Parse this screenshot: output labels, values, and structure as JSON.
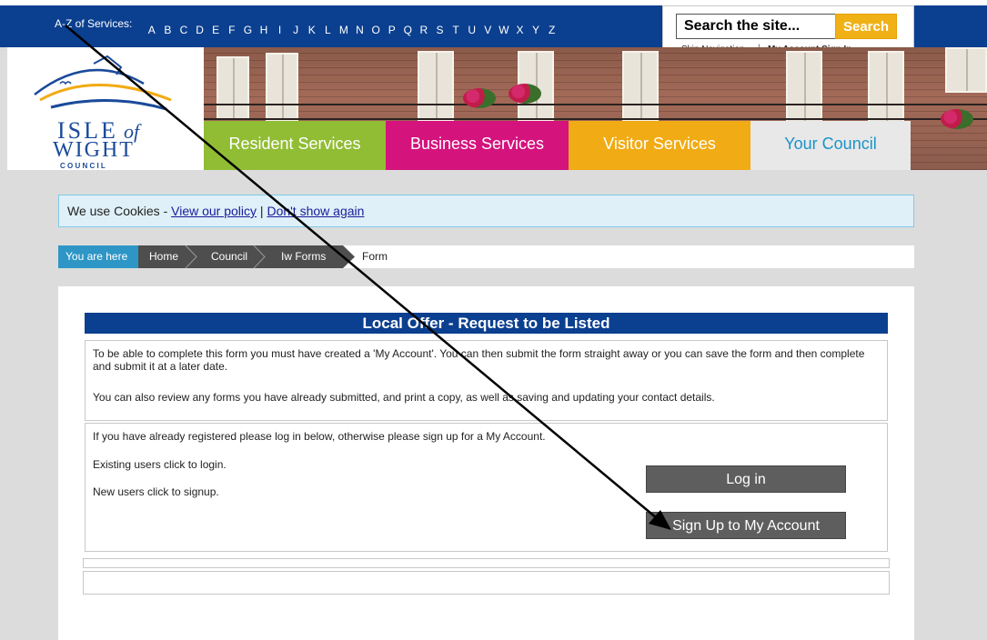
{
  "az_bar": {
    "label": "A-Z of Services:",
    "letters": [
      "A",
      "B",
      "C",
      "D",
      "E",
      "F",
      "G",
      "H",
      "I",
      "J",
      "K",
      "L",
      "M",
      "N",
      "O",
      "P",
      "Q",
      "R",
      "S",
      "T",
      "U",
      "V",
      "W",
      "X",
      "Y",
      "Z"
    ]
  },
  "search": {
    "placeholder": "Search the site...",
    "button_label": "Search",
    "skip_navigation": "Skip Navigation",
    "separator": "|",
    "account_sign_in": "My Account Sign In"
  },
  "logo": {
    "line1": "ISLE",
    "line1_of": "of",
    "line2": "WIGHT",
    "line3": "C O U N C I L"
  },
  "nav": {
    "resident": "Resident Services",
    "business": "Business Services",
    "visitor": "Visitor Services",
    "council": "Your Council"
  },
  "cookie": {
    "prefix": "We use Cookies - ",
    "policy_link": "View our policy",
    "divider": " | ",
    "dismiss_link": "Don't show again"
  },
  "breadcrumb": {
    "you_are_here": "You are here",
    "items": [
      "Home",
      "Council",
      "Iw Forms"
    ],
    "current": "Form"
  },
  "form": {
    "title": "Local Offer - Request to be Listed",
    "intro_para1": "To be able to complete this form you must have created a 'My Account'. You can then submit the form straight away or you can save the form and then complete and submit it at a later date.",
    "intro_para2": "You can also review any forms you have already submitted, and print a copy, as well as saving and updating your contact details.",
    "login_prompt": "If you have already registered please log in below, otherwise please sign up for a My Account.",
    "existing_users": "Existing users click to login.",
    "new_users": "New users click to signup.",
    "login_button": "Log in",
    "signup_button": "Sign Up to My Account"
  },
  "colors": {
    "brand_blue": "#0b3f8f",
    "resident_green": "#91bd35",
    "business_pink": "#d4137d",
    "visitor_orange": "#f1ab14",
    "breadcrumb_blue": "#2e96c6",
    "button_gray": "#5e5e5e",
    "annotation_arrow": "#000000"
  },
  "icons": {
    "logo_swoosh": "swoosh-logo-icon",
    "breadcrumb_chevron": "chevron-right-icon",
    "annotation": "arrow-pointer-icon"
  }
}
